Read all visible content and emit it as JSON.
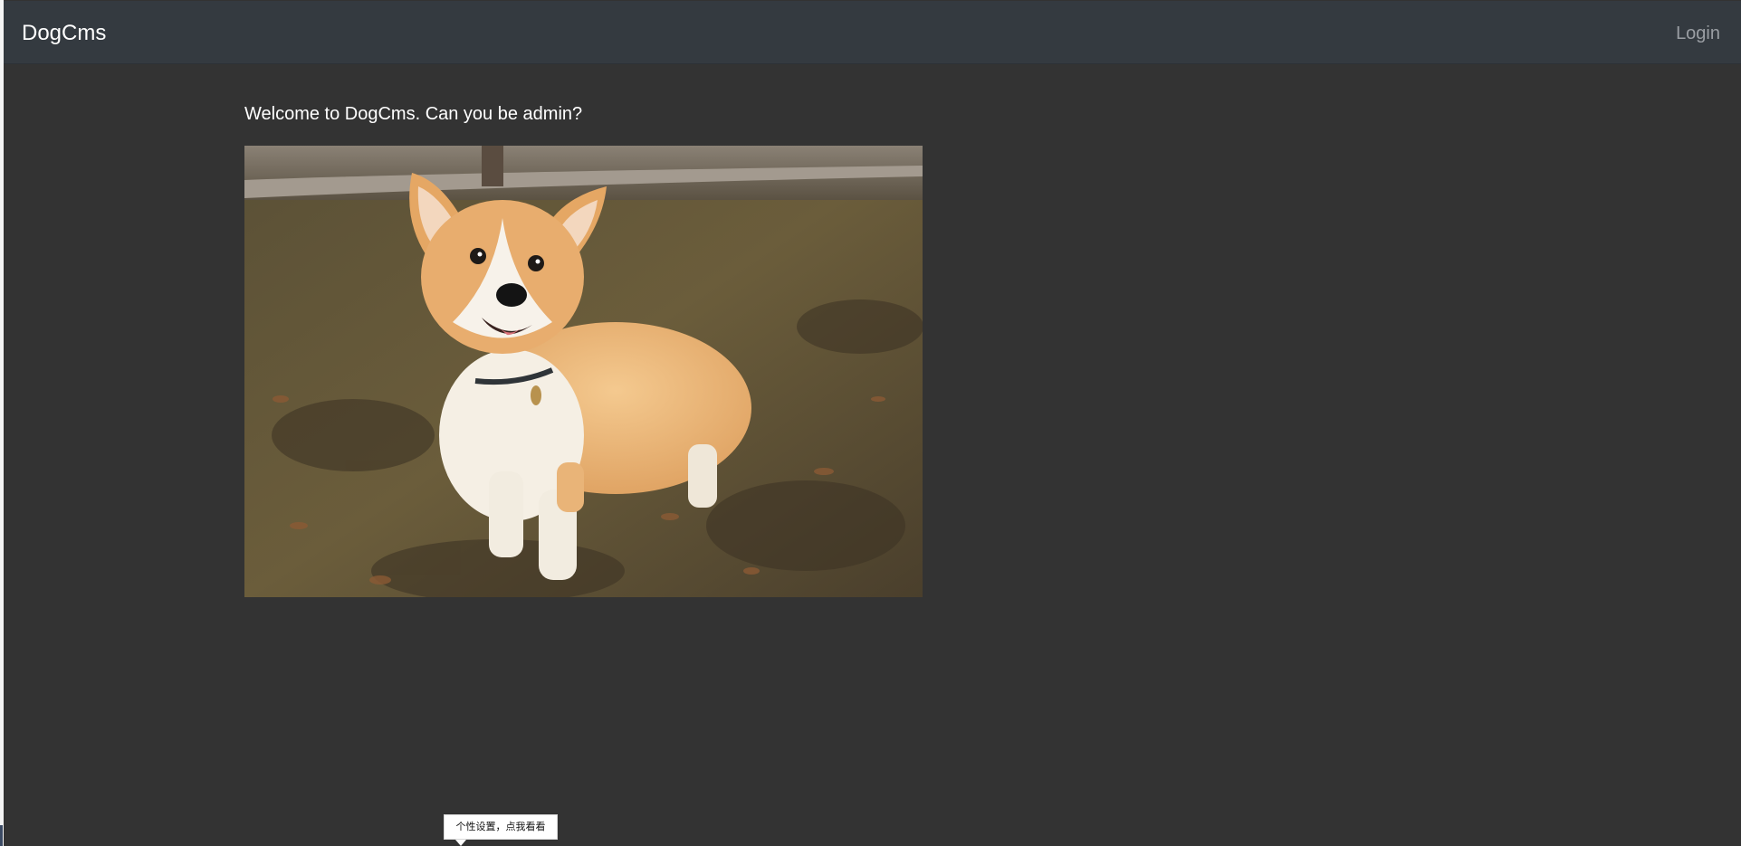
{
  "navbar": {
    "brand": "DogCms",
    "login_label": "Login"
  },
  "main": {
    "welcome_text": "Welcome to DogCms. Can you be admin?",
    "image_subject": "corgi-dog-photo"
  },
  "tooltip": {
    "text": "个性设置，点我看看"
  },
  "colors": {
    "page_background": "#333333",
    "navbar_background": "#343a40",
    "brand_text": "#ffffff",
    "login_text": "#9a9ea3"
  }
}
